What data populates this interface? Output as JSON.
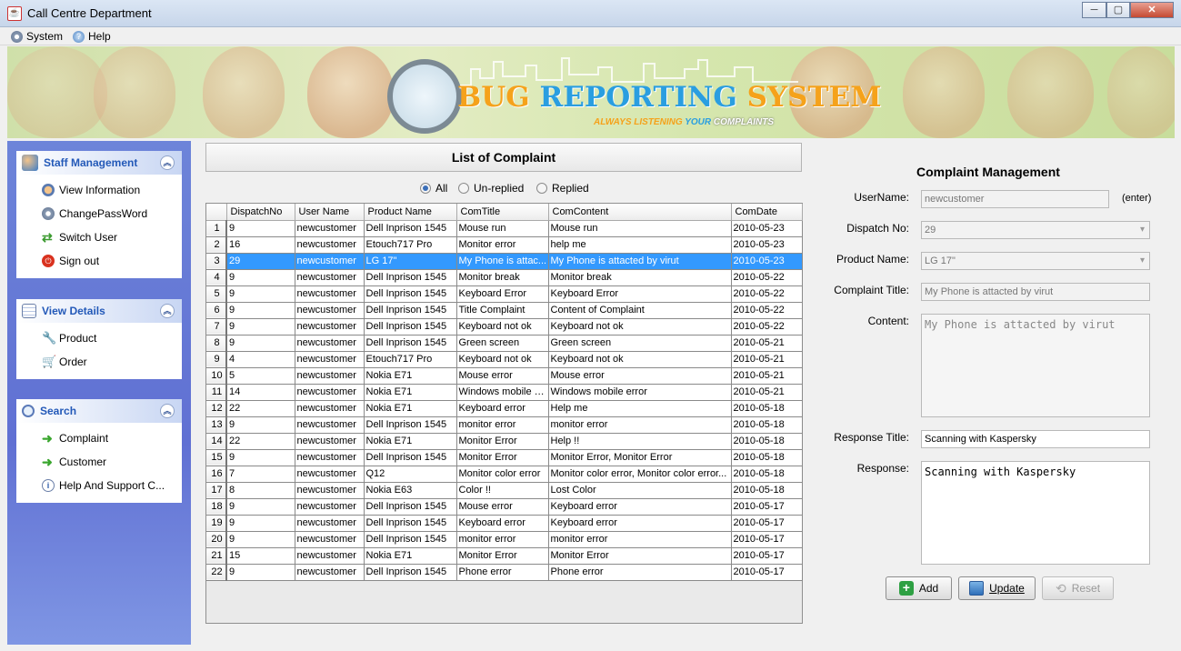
{
  "window": {
    "title": "Call Centre Department",
    "app_icon": "java-cup-icon"
  },
  "menu": [
    {
      "label": "System",
      "icon": "gear-icon"
    },
    {
      "label": "Help",
      "icon": "help-icon"
    }
  ],
  "banner": {
    "title_part1": "BUG",
    "title_part2": "REPORTING",
    "title_part3": "SYSTEM",
    "subtitle_part1": "ALWAYS LISTENING",
    "subtitle_part2": "YOUR",
    "subtitle_part3": "COMPLAINTS",
    "colors": {
      "bug": "#f5a21b",
      "reporting": "#2a9ee0",
      "system": "#f5a21b"
    }
  },
  "sidebar": {
    "staff": {
      "title": "Staff Management",
      "items": [
        {
          "label": "View Information",
          "icon": "user-info-icon"
        },
        {
          "label": "ChangePassWord",
          "icon": "gear-icon"
        },
        {
          "label": "Switch User",
          "icon": "switch-arrows-icon"
        },
        {
          "label": "Sign out",
          "icon": "power-icon"
        }
      ]
    },
    "view": {
      "title": "View Details",
      "items": [
        {
          "label": "Product",
          "icon": "wrench-icon"
        },
        {
          "label": "Order",
          "icon": "cart-icon"
        }
      ]
    },
    "search": {
      "title": "Search",
      "items": [
        {
          "label": "Complaint",
          "icon": "arrow-right-icon"
        },
        {
          "label": "Customer",
          "icon": "arrow-right-icon"
        },
        {
          "label": "Help And Support C...",
          "icon": "info-icon"
        }
      ]
    }
  },
  "list": {
    "title": "List of Complaint",
    "filters": [
      {
        "label": "All",
        "selected": true
      },
      {
        "label": "Un-replied",
        "selected": false
      },
      {
        "label": "Replied",
        "selected": false
      }
    ],
    "columns": [
      "",
      "DispatchNo",
      "User Name",
      "Product Name",
      "ComTitle",
      "ComContent",
      "ComDate"
    ],
    "selected_row": 2,
    "rows": [
      [
        "1",
        "9",
        "newcustomer",
        "Dell Inprison 1545",
        "Mouse run",
        "Mouse run",
        "2010-05-23"
      ],
      [
        "2",
        "16",
        "newcustomer",
        "Etouch717 Pro",
        "Monitor error",
        "help me",
        "2010-05-23"
      ],
      [
        "3",
        "29",
        "newcustomer",
        "LG 17\"",
        "My Phone is attac...",
        "My Phone is attacted by virut",
        "2010-05-23"
      ],
      [
        "4",
        "9",
        "newcustomer",
        "Dell Inprison 1545",
        "Monitor break",
        "Monitor break",
        "2010-05-22"
      ],
      [
        "5",
        "9",
        "newcustomer",
        "Dell Inprison 1545",
        "Keyboard Error",
        "Keyboard Error",
        "2010-05-22"
      ],
      [
        "6",
        "9",
        "newcustomer",
        "Dell Inprison 1545",
        "Title Complaint",
        "Content of Complaint",
        "2010-05-22"
      ],
      [
        "7",
        "9",
        "newcustomer",
        "Dell Inprison 1545",
        "Keyboard not ok",
        "Keyboard not ok",
        "2010-05-22"
      ],
      [
        "8",
        "9",
        "newcustomer",
        "Dell Inprison 1545",
        "Green screen",
        "Green screen",
        "2010-05-21"
      ],
      [
        "9",
        "4",
        "newcustomer",
        "Etouch717 Pro",
        "Keyboard not ok",
        "Keyboard not ok",
        "2010-05-21"
      ],
      [
        "10",
        "5",
        "newcustomer",
        "Nokia E71",
        "Mouse error",
        "Mouse error",
        "2010-05-21"
      ],
      [
        "11",
        "14",
        "newcustomer",
        "Nokia E71",
        "Windows mobile e...",
        "Windows mobile error",
        "2010-05-21"
      ],
      [
        "12",
        "22",
        "newcustomer",
        "Nokia E71",
        "Keyboard error",
        "Help me",
        "2010-05-18"
      ],
      [
        "13",
        "9",
        "newcustomer",
        "Dell Inprison 1545",
        "monitor error",
        "monitor error",
        "2010-05-18"
      ],
      [
        "14",
        "22",
        "newcustomer",
        "Nokia E71",
        "Monitor Error",
        "Help !!",
        "2010-05-18"
      ],
      [
        "15",
        "9",
        "newcustomer",
        "Dell Inprison 1545",
        "Monitor Error",
        "Monitor Error, Monitor Error",
        "2010-05-18"
      ],
      [
        "16",
        "7",
        "newcustomer",
        "Q12",
        "Monitor color error",
        "Monitor color error, Monitor color error...",
        "2010-05-18"
      ],
      [
        "17",
        "8",
        "newcustomer",
        "Nokia E63",
        "Color !!",
        "Lost Color",
        "2010-05-18"
      ],
      [
        "18",
        "9",
        "newcustomer",
        "Dell Inprison 1545",
        "Mouse error",
        "Keyboard error",
        "2010-05-17"
      ],
      [
        "19",
        "9",
        "newcustomer",
        "Dell Inprison 1545",
        "Keyboard error",
        "Keyboard error",
        "2010-05-17"
      ],
      [
        "20",
        "9",
        "newcustomer",
        "Dell Inprison 1545",
        "monitor error",
        "monitor error",
        "2010-05-17"
      ],
      [
        "21",
        "15",
        "newcustomer",
        "Nokia E71",
        "Monitor Error",
        "Monitor Error",
        "2010-05-17"
      ],
      [
        "22",
        "9",
        "newcustomer",
        "Dell Inprison 1545",
        "Phone error",
        "Phone error",
        "2010-05-17"
      ]
    ]
  },
  "form": {
    "title": "Complaint Management",
    "username_label": "UserName:",
    "username_value": "newcustomer",
    "username_hint": "(enter)",
    "dispatch_label": "Dispatch No:",
    "dispatch_value": "29",
    "product_label": "Product Name:",
    "product_value": "LG 17\"",
    "ctitle_label": "Complaint Title:",
    "ctitle_value": "My Phone is attacted by virut",
    "content_label": "Content:",
    "content_value": "My Phone is attacted by virut",
    "rtitle_label": "Response Title:",
    "rtitle_value": "Scanning with Kaspersky",
    "response_label": "Response:",
    "response_value": "Scanning with Kaspersky",
    "add_label": "Add",
    "update_label": "Update",
    "reset_label": "Reset"
  }
}
